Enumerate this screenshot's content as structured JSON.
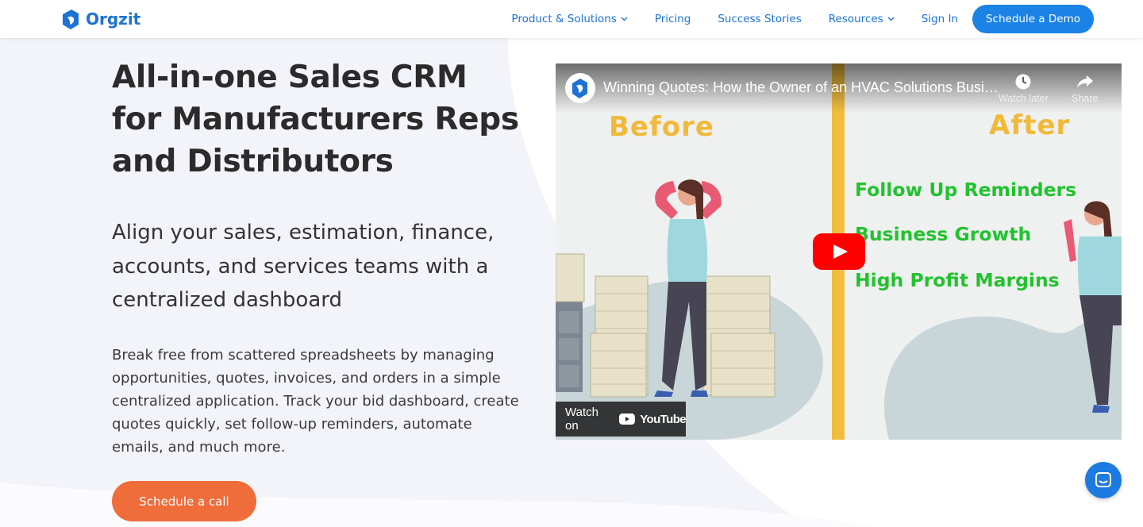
{
  "brand": {
    "name": "Orgzit"
  },
  "nav": {
    "items": [
      {
        "label": "Product & Solutions",
        "has_dropdown": true
      },
      {
        "label": "Pricing",
        "has_dropdown": false
      },
      {
        "label": "Success Stories",
        "has_dropdown": false
      },
      {
        "label": "Resources",
        "has_dropdown": true
      },
      {
        "label": "Sign In",
        "has_dropdown": false
      }
    ],
    "cta_label": "Schedule a Demo"
  },
  "hero": {
    "title_lines": [
      "All-in-one Sales CRM",
      "for Manufacturers Reps",
      "and Distributors"
    ],
    "subtitle_lines": [
      "Align your sales, estimation, finance,",
      "accounts, and services teams with a",
      "centralized dashboard"
    ],
    "body_lines": [
      "Break free from scattered spreadsheets by managing",
      "opportunities, quotes, invoices, and orders in a simple",
      "centralized application. Track your bid dashboard, create",
      "quotes quickly, set follow-up reminders, automate",
      "emails, and much more."
    ],
    "cta_label": "Schedule a call"
  },
  "video": {
    "title": "Winning Quotes: How the Owner of an HVAC Solutions Business...",
    "watch_later_label": "Watch later",
    "share_label": "Share",
    "before_label": "Before",
    "after_label": "After",
    "features": [
      "Follow Up Reminders",
      "Business Growth",
      "High Profit Margins"
    ],
    "watch_on_label": "Watch on",
    "youtube_label": "YouTube"
  },
  "colors": {
    "primary": "#1b82e6",
    "cta_orange": "#ef6c3b",
    "title_text": "#2b2b2b",
    "before_after_yellow": "#f0b93a",
    "feature_green": "#22c22e",
    "youtube_red": "#ff0000"
  },
  "icons": {
    "logo": "orgzit-logo-icon",
    "dropdown": "chevron-down-icon",
    "watch_later": "clock-icon",
    "share": "share-arrow-icon",
    "play": "youtube-play-icon",
    "chat": "chat-bubble-icon"
  }
}
